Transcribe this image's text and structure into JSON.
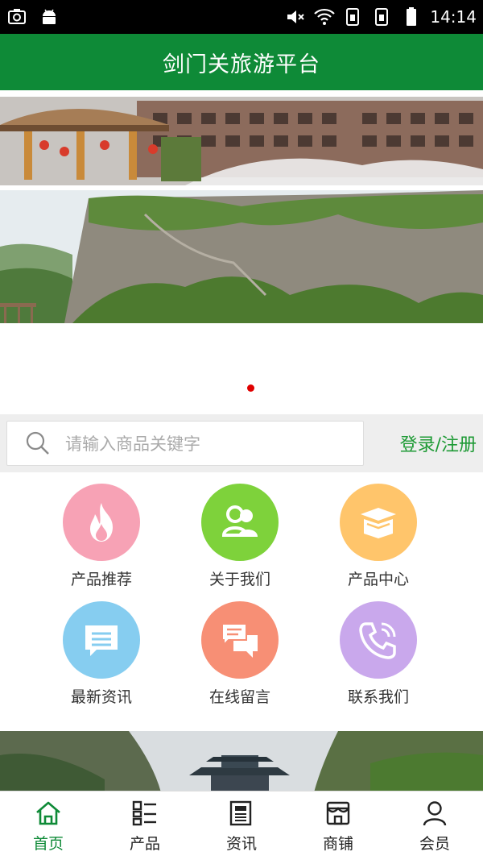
{
  "status_bar": {
    "time": "14:14"
  },
  "app": {
    "title": "剑门关旅游平台",
    "accent_color": "#0e8a37"
  },
  "banner": {
    "indicator_count": 1,
    "active_indicator_color": "#e00000"
  },
  "search": {
    "placeholder": "请输入商品关键字",
    "login_label": "登录/注册"
  },
  "menu": [
    {
      "label": "产品推荐",
      "icon": "fire-icon",
      "color": "#f7a2b5"
    },
    {
      "label": "关于我们",
      "icon": "users-icon",
      "color": "#7ed23b"
    },
    {
      "label": "产品中心",
      "icon": "box-icon",
      "color": "#ffc56b"
    },
    {
      "label": "最新资讯",
      "icon": "message-icon",
      "color": "#86cdf0"
    },
    {
      "label": "在线留言",
      "icon": "chat-icon",
      "color": "#f78f75"
    },
    {
      "label": "联系我们",
      "icon": "phone-icon",
      "color": "#c9a8ec"
    }
  ],
  "tabs": [
    {
      "label": "首页",
      "icon": "home-icon",
      "active": true
    },
    {
      "label": "产品",
      "icon": "list-icon",
      "active": false
    },
    {
      "label": "资讯",
      "icon": "news-icon",
      "active": false
    },
    {
      "label": "商铺",
      "icon": "shop-icon",
      "active": false
    },
    {
      "label": "会员",
      "icon": "user-icon",
      "active": false
    }
  ]
}
